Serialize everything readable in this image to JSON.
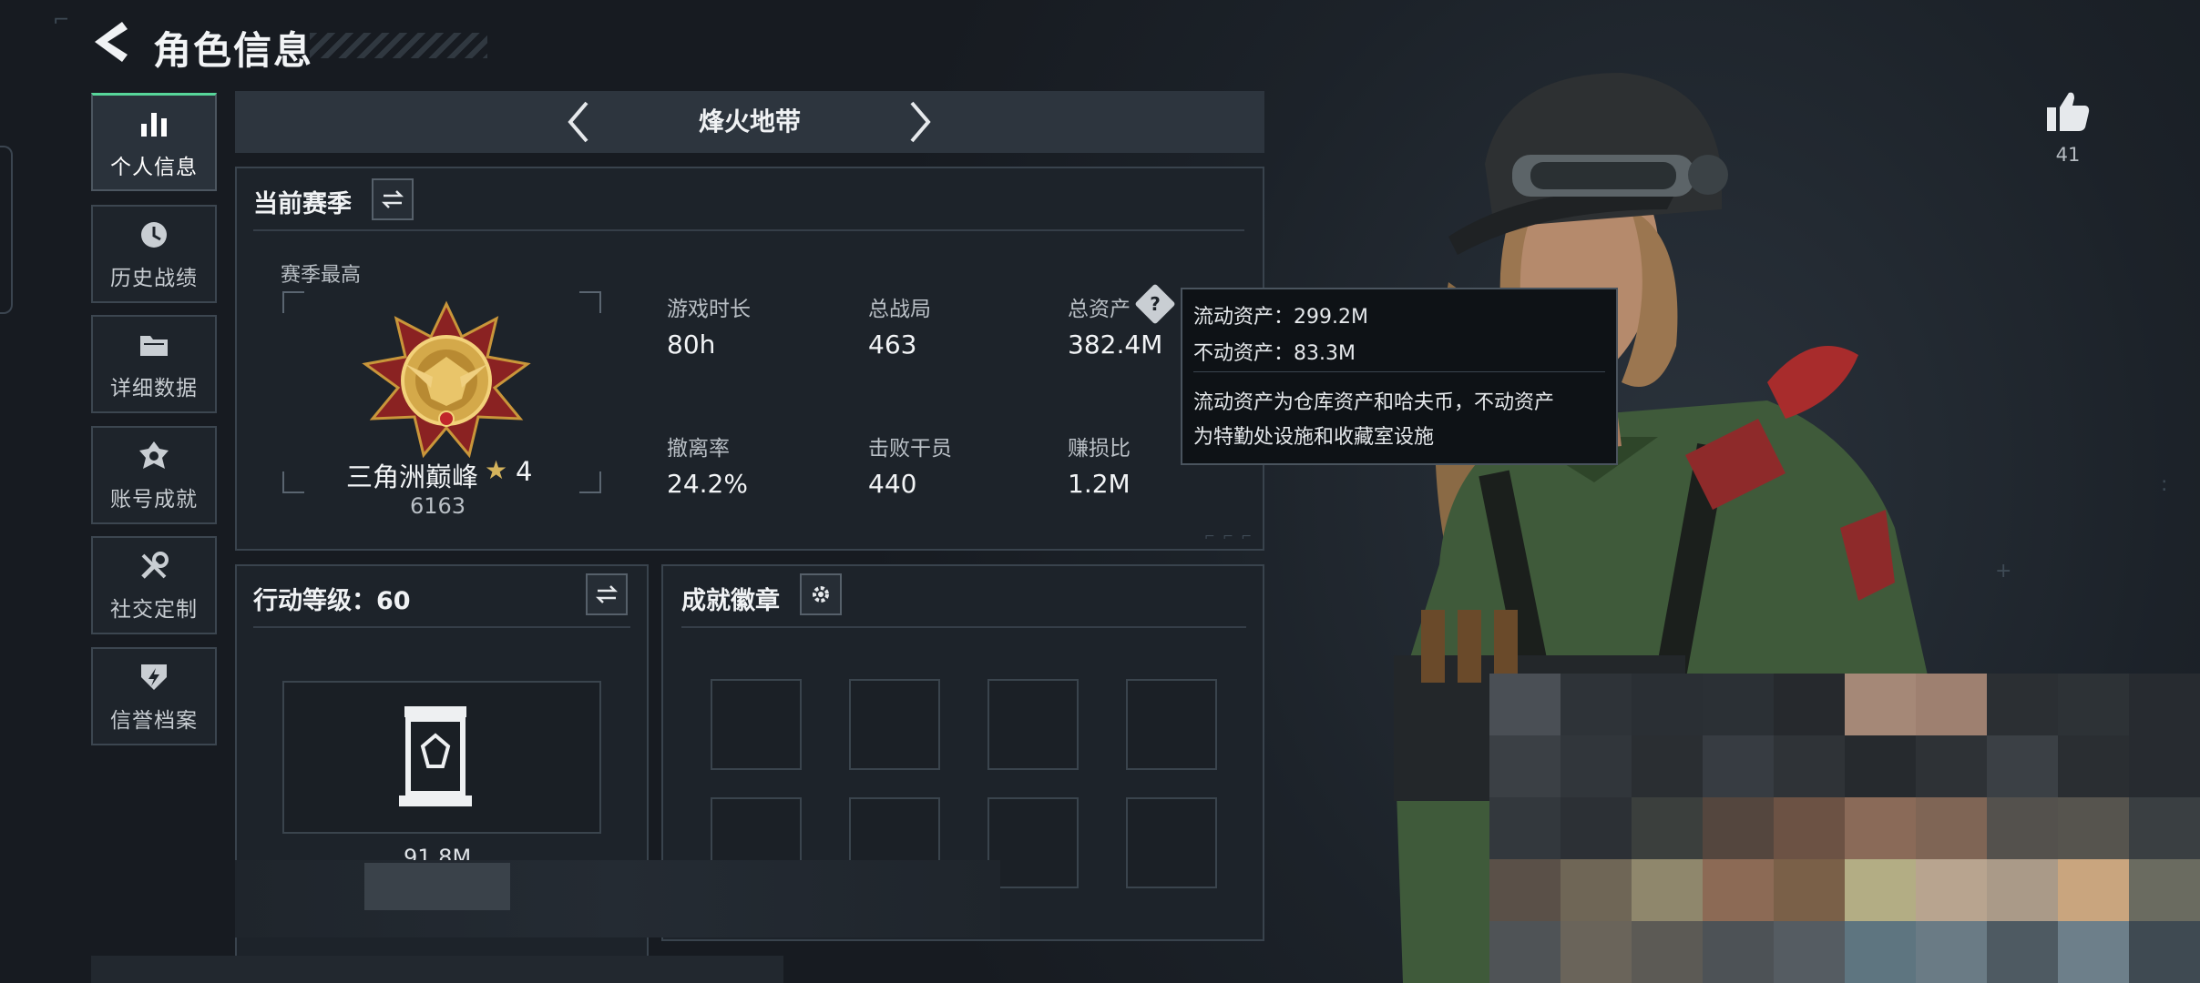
{
  "header": {
    "title": "角色信息"
  },
  "sidebar": {
    "items": [
      {
        "label": "个人信息",
        "icon": "bar-chart-icon",
        "active": true
      },
      {
        "label": "历史战绩",
        "icon": "history-clock-icon",
        "active": false
      },
      {
        "label": "详细数据",
        "icon": "folder-icon",
        "active": false
      },
      {
        "label": "账号成就",
        "icon": "achievement-icon",
        "active": false
      },
      {
        "label": "社交定制",
        "icon": "wrench-icon",
        "active": false
      },
      {
        "label": "信誉档案",
        "icon": "credit-shield-icon",
        "active": false
      }
    ]
  },
  "map_selector": {
    "current": "烽火地带"
  },
  "season": {
    "title": "当前赛季",
    "best_label": "赛季最高",
    "rank_name": "三角洲巅峰",
    "rank_stars": "4",
    "rank_score": "6163",
    "stats": [
      {
        "label": "游戏时长",
        "value": "80h"
      },
      {
        "label": "总战局",
        "value": "463"
      },
      {
        "label": "总资产",
        "value": "382.4M"
      },
      {
        "label": "撤离率",
        "value": "24.2%"
      },
      {
        "label": "击败干员",
        "value": "440"
      },
      {
        "label": "赚损比",
        "value": "1.2M"
      }
    ]
  },
  "tooltip": {
    "liquid": "流动资产：299.2M",
    "fixed": "不动资产：83.3M",
    "desc_line1": "流动资产为仓库资产和哈夫币，不动资产",
    "desc_line2": "为特勤处设施和收藏室设施"
  },
  "action_level": {
    "title": "行动等级：60",
    "value": "91.8M"
  },
  "achievements": {
    "title": "成就徽章"
  },
  "likes": {
    "count": "41"
  },
  "colors": {
    "accent_green": "#57d69a",
    "panel_bg": "#1d232a",
    "gold": "#d4a94a",
    "red_ribbon": "#b22d2d"
  }
}
